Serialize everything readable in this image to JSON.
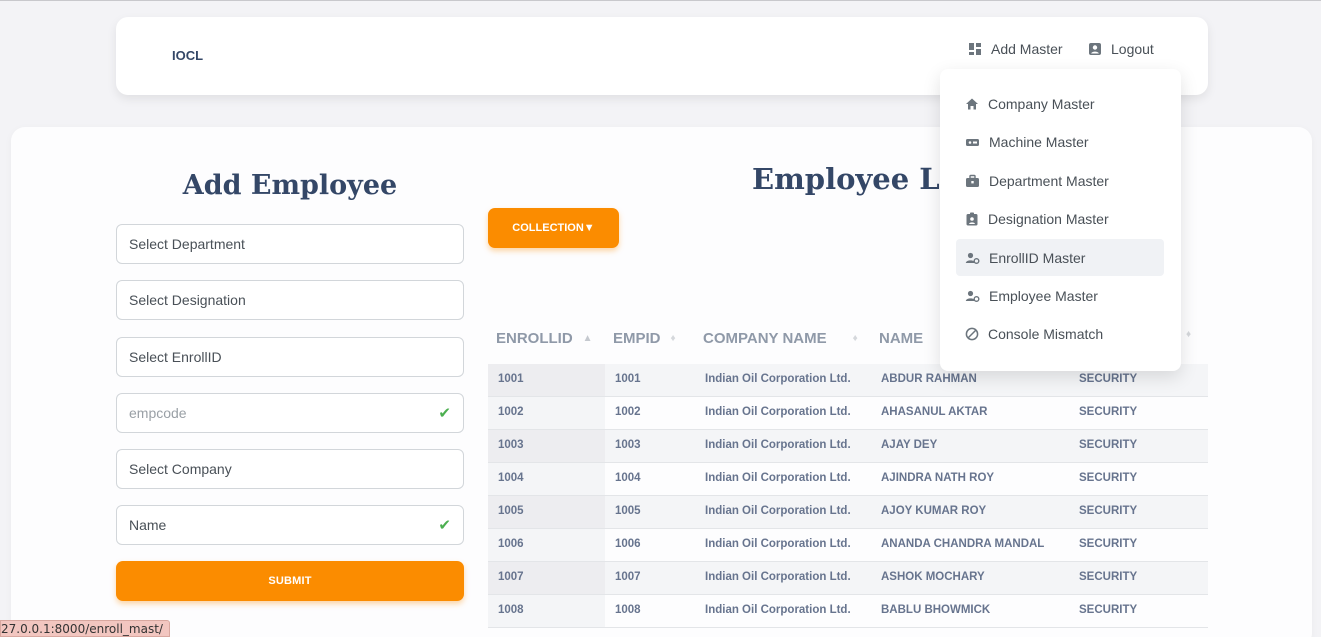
{
  "navbar": {
    "brand": "IOCL",
    "add_master": "Add Master",
    "logout": "Logout"
  },
  "dropdown": {
    "items": [
      {
        "label": "Company Master",
        "icon": "home-icon"
      },
      {
        "label": "Machine Master",
        "icon": "machine-icon"
      },
      {
        "label": "Department Master",
        "icon": "briefcase-icon"
      },
      {
        "label": "Designation Master",
        "icon": "badge-icon"
      },
      {
        "label": "EnrollID Master",
        "icon": "user-gear-icon"
      },
      {
        "label": "Employee Master",
        "icon": "user-gear-icon"
      },
      {
        "label": "Console Mismatch",
        "icon": "block-icon"
      }
    ]
  },
  "form": {
    "title": "Add Employee",
    "department": "Select Department",
    "designation": "Select Designation",
    "enrollid": "Select EnrollID",
    "empcode_placeholder": "empcode",
    "company": "Select Company",
    "name_placeholder": "Name",
    "submit": "SUBMIT"
  },
  "list": {
    "title": "Employee List",
    "collection": "COLLECTION▼",
    "headers": [
      "ENROLLID",
      "EMPID",
      "COMPANY NAME",
      "NAME"
    ],
    "rows": [
      [
        "1001",
        "1001",
        "Indian Oil Corporation Ltd.",
        "ABDUR RAHMAN",
        "SECURITY"
      ],
      [
        "1002",
        "1002",
        "Indian Oil Corporation Ltd.",
        "AHASANUL AKTAR",
        "SECURITY"
      ],
      [
        "1003",
        "1003",
        "Indian Oil Corporation Ltd.",
        "AJAY DEY",
        "SECURITY"
      ],
      [
        "1004",
        "1004",
        "Indian Oil Corporation Ltd.",
        "AJINDRA NATH ROY",
        "SECURITY"
      ],
      [
        "1005",
        "1005",
        "Indian Oil Corporation Ltd.",
        "AJOY KUMAR ROY",
        "SECURITY"
      ],
      [
        "1006",
        "1006",
        "Indian Oil Corporation Ltd.",
        "ANANDA CHANDRA MANDAL",
        "SECURITY"
      ],
      [
        "1007",
        "1007",
        "Indian Oil Corporation Ltd.",
        "ASHOK MOCHARY",
        "SECURITY"
      ],
      [
        "1008",
        "1008",
        "Indian Oil Corporation Ltd.",
        "BABLU BHOWMICK",
        "SECURITY"
      ]
    ]
  },
  "status_bar": {
    "url": "27.0.0.1:8000/enroll_mast/"
  },
  "colors": {
    "accent": "#fb8c00",
    "heading": "#344767",
    "check": "#4caf50"
  }
}
